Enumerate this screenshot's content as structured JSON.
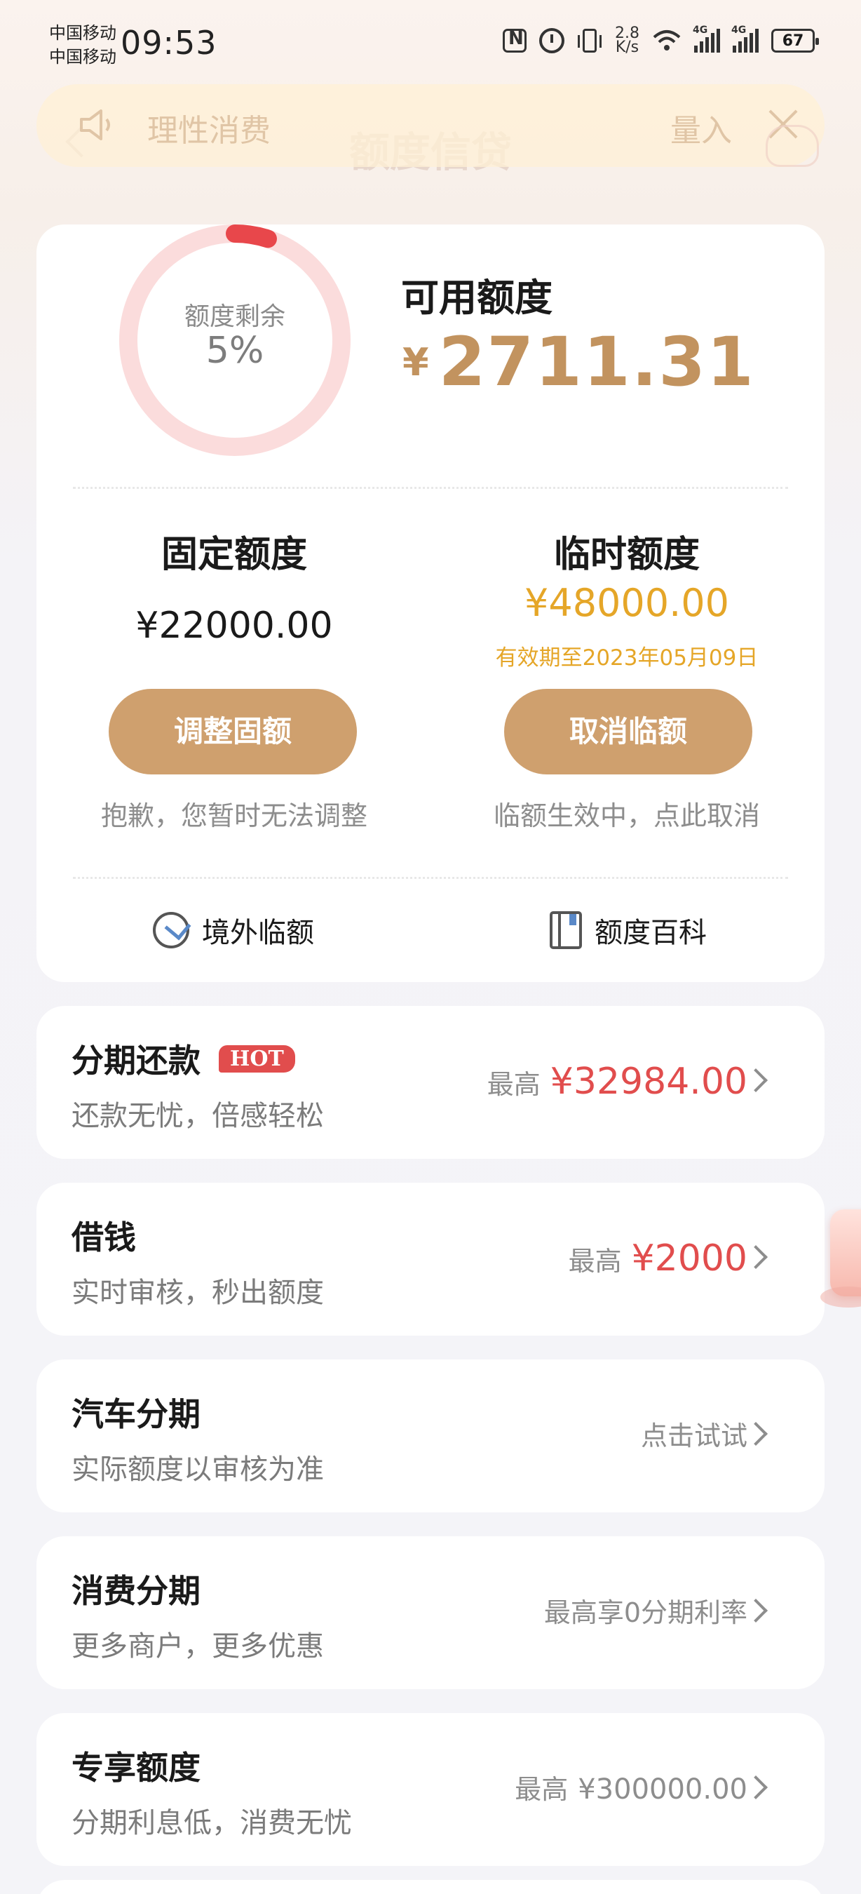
{
  "status_bar": {
    "carrier_1": "中国移动",
    "carrier_2": "中国移动",
    "time": "09:53",
    "speed_value": "2.8",
    "speed_unit": "K/s",
    "network_1": "4G",
    "network_2": "4G",
    "battery": "67"
  },
  "header": {
    "title": "额度信贷",
    "notice_text": "理性消费",
    "notice_action": "量入",
    "colors": {
      "notice_bg": "#fff0d6",
      "notice_text": "#e0c5a6"
    }
  },
  "quota": {
    "ring_label": "额度剩余",
    "ring_value": "5%",
    "ring_fraction": 0.05,
    "available_title": "可用额度",
    "available_symbol": "¥",
    "available_amount": "2711.31",
    "fixed": {
      "title": "固定额度",
      "amount": "¥22000.00",
      "button": "调整固额",
      "note": "抱歉，您暂时无法调整"
    },
    "temporary": {
      "title": "临时额度",
      "amount": "¥48000.00",
      "validity": "有效期至2023年05月09日",
      "button": "取消临额",
      "note": "临额生效中，点此取消"
    },
    "links": {
      "overseas": "境外临额",
      "encyclopedia": "额度百科"
    },
    "colors": {
      "accent": "#c2935f",
      "button": "#cfa06e",
      "temp": "#e5a628",
      "ring_track": "#fbdcdc",
      "ring_fill": "#e8474b"
    }
  },
  "products": [
    {
      "title": "分期还款",
      "badge": "HOT",
      "subtitle": "还款无忧，倍感轻松",
      "right_prefix": "最高",
      "right_amount": "¥32984.00"
    },
    {
      "title": "借钱",
      "subtitle": "实时审核，秒出额度",
      "right_prefix": "最高",
      "right_amount": "¥2000"
    },
    {
      "title": "汽车分期",
      "subtitle": "实际额度以审核为准",
      "right_text": "点击试试"
    },
    {
      "title": "消费分期",
      "subtitle": "更多商户，更多优惠",
      "right_text": "最高享0分期利率"
    },
    {
      "title": "专享额度",
      "subtitle": "分期利息低，消费无忧",
      "right_prefix": "最高",
      "right_amount_grey": "¥300000.00"
    }
  ]
}
